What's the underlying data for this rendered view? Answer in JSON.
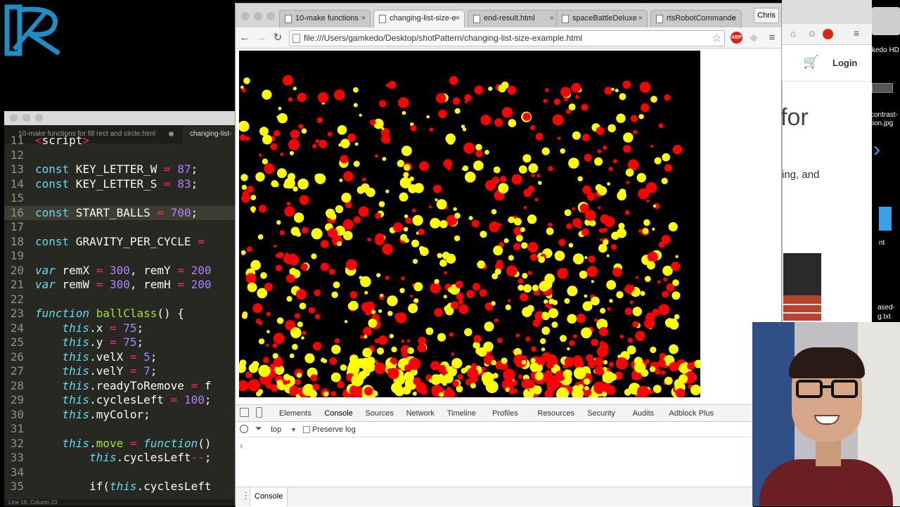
{
  "desktop": {
    "icons": [
      {
        "label": "kedo HD"
      },
      {
        "label": "contrast-"
      },
      {
        "label": "tion.jpg"
      },
      {
        "label": "nt"
      },
      {
        "label": "ased-"
      },
      {
        "label": "g.txt"
      }
    ]
  },
  "background_browser": {
    "login_label": "Login",
    "headline_fragment": "for",
    "body_fragment": "ing, and"
  },
  "editor": {
    "tabs": [
      {
        "label": "10-make functions for fill rect and circle.html"
      },
      {
        "label": "changing-list-"
      }
    ],
    "status": "Line 16, Column 23",
    "lines": [
      {
        "num": "11",
        "text": "<script>"
      },
      {
        "num": "12",
        "text": ""
      },
      {
        "num": "13",
        "text": "const KEY_LETTER_W = 87;"
      },
      {
        "num": "14",
        "text": "const KEY_LETTER_S = 83;"
      },
      {
        "num": "15",
        "text": ""
      },
      {
        "num": "16",
        "text": "const START_BALLS = 700;"
      },
      {
        "num": "17",
        "text": ""
      },
      {
        "num": "18",
        "text": "const GRAVITY_PER_CYCLE ="
      },
      {
        "num": "19",
        "text": ""
      },
      {
        "num": "20",
        "text": "var remX = 300, remY = 200"
      },
      {
        "num": "21",
        "text": "var remW = 300, remH = 200"
      },
      {
        "num": "22",
        "text": ""
      },
      {
        "num": "23",
        "text": "function ballClass() {"
      },
      {
        "num": "24",
        "text": "    this.x = 75;"
      },
      {
        "num": "25",
        "text": "    this.y = 75;"
      },
      {
        "num": "26",
        "text": "    this.velX = 5;"
      },
      {
        "num": "27",
        "text": "    this.velY = 7;"
      },
      {
        "num": "28",
        "text": "    this.readyToRemove = f"
      },
      {
        "num": "29",
        "text": "    this.cyclesLeft = 100;"
      },
      {
        "num": "30",
        "text": "    this.myColor;"
      },
      {
        "num": "31",
        "text": ""
      },
      {
        "num": "32",
        "text": "    this.move = function()"
      },
      {
        "num": "33",
        "text": "        this.cyclesLeft--;"
      },
      {
        "num": "34",
        "text": ""
      },
      {
        "num": "35",
        "text": "        if(this.cyclesLeft"
      }
    ]
  },
  "browser": {
    "tabs": [
      {
        "label": "10-make functions",
        "active": false
      },
      {
        "label": "changing-list-size-e",
        "active": true
      },
      {
        "label": "end-result.html",
        "active": false
      },
      {
        "label": "spaceBattleDeluxe",
        "active": false
      },
      {
        "label": "rtsRobotCommande",
        "active": false
      }
    ],
    "profile_name": "Chris",
    "url": "file:///Users/gamkedo/Desktop/shotPattern/changing-list-size-example.html",
    "abp_label": "ABP",
    "canvas": {
      "background": "#000000",
      "ball_colors": [
        "#ff0000",
        "#ffff00"
      ],
      "ball_count": 700
    }
  },
  "devtools": {
    "tabs": [
      "Elements",
      "Console",
      "Sources",
      "Network",
      "Timeline",
      "Profiles",
      "Resources",
      "Security",
      "Audits",
      "Adblock Plus"
    ],
    "active_tab": "Console",
    "context": "top",
    "preserve_log_label": "Preserve log",
    "prompt": "›",
    "drawer_tab": "Console"
  },
  "colors": {
    "editor_bg": "#272822",
    "keyword": "#66d9ef",
    "operator": "#f92672",
    "number": "#ae81ff",
    "function_name": "#a6e22e",
    "devtools_active": "#3879d9"
  }
}
